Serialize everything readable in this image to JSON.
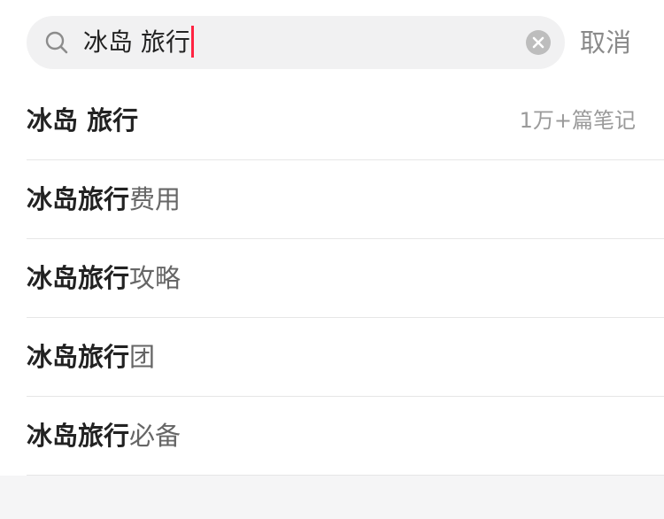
{
  "search": {
    "query": "冰岛 旅行",
    "cancel_label": "取消",
    "caret_color": "#ff2442",
    "search_icon": "search-icon",
    "clear_icon": "clear-circle-x-icon"
  },
  "suggestions": [
    {
      "highlight": "冰岛 旅行",
      "rest": "",
      "count": "1万+篇笔记"
    },
    {
      "highlight": "冰岛旅行",
      "rest": "费用",
      "count": ""
    },
    {
      "highlight": "冰岛旅行",
      "rest": "攻略",
      "count": ""
    },
    {
      "highlight": "冰岛旅行",
      "rest": "团",
      "count": ""
    },
    {
      "highlight": "冰岛旅行",
      "rest": "必备",
      "count": ""
    }
  ]
}
